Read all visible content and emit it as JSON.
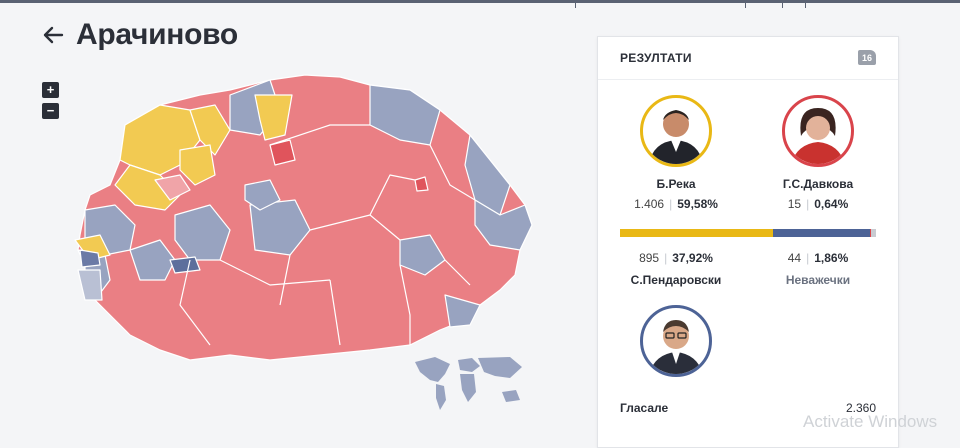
{
  "header": {
    "title": "Арачиново",
    "back_icon": "arrow-left-icon"
  },
  "map_controls": {
    "zoom_in": "+",
    "zoom_out": "−"
  },
  "colors": {
    "reka": "#e9b815",
    "davkova": "#4d6396",
    "pendarovski": "#e8747a",
    "invalid": "#c8cbd1",
    "map_red": "#ea7f84",
    "map_blue": "#98a3c0",
    "map_yellow": "#f2ca52"
  },
  "results": {
    "heading": "РЕЗУЛТАТИ",
    "badge": "16",
    "candidates": [
      {
        "name": "Б.Река",
        "votes": "1.406",
        "pct": "59,58%",
        "share": 59.58,
        "ring": "#e9b815"
      },
      {
        "name": "Г.С.Давкова",
        "votes": "15",
        "pct": "0,64%",
        "share": 0.64,
        "ring": "#d9444b"
      },
      {
        "name": "С.Пендаровски",
        "votes": "895",
        "pct": "37,92%",
        "share": 37.92,
        "ring": "#4d6396"
      },
      {
        "name": "Неважечки",
        "votes": "44",
        "pct": "1,86%",
        "share": 1.86
      }
    ],
    "summary": [
      {
        "label": "Гласале",
        "value": "2.360"
      }
    ]
  },
  "watermark": "Activate Windows"
}
